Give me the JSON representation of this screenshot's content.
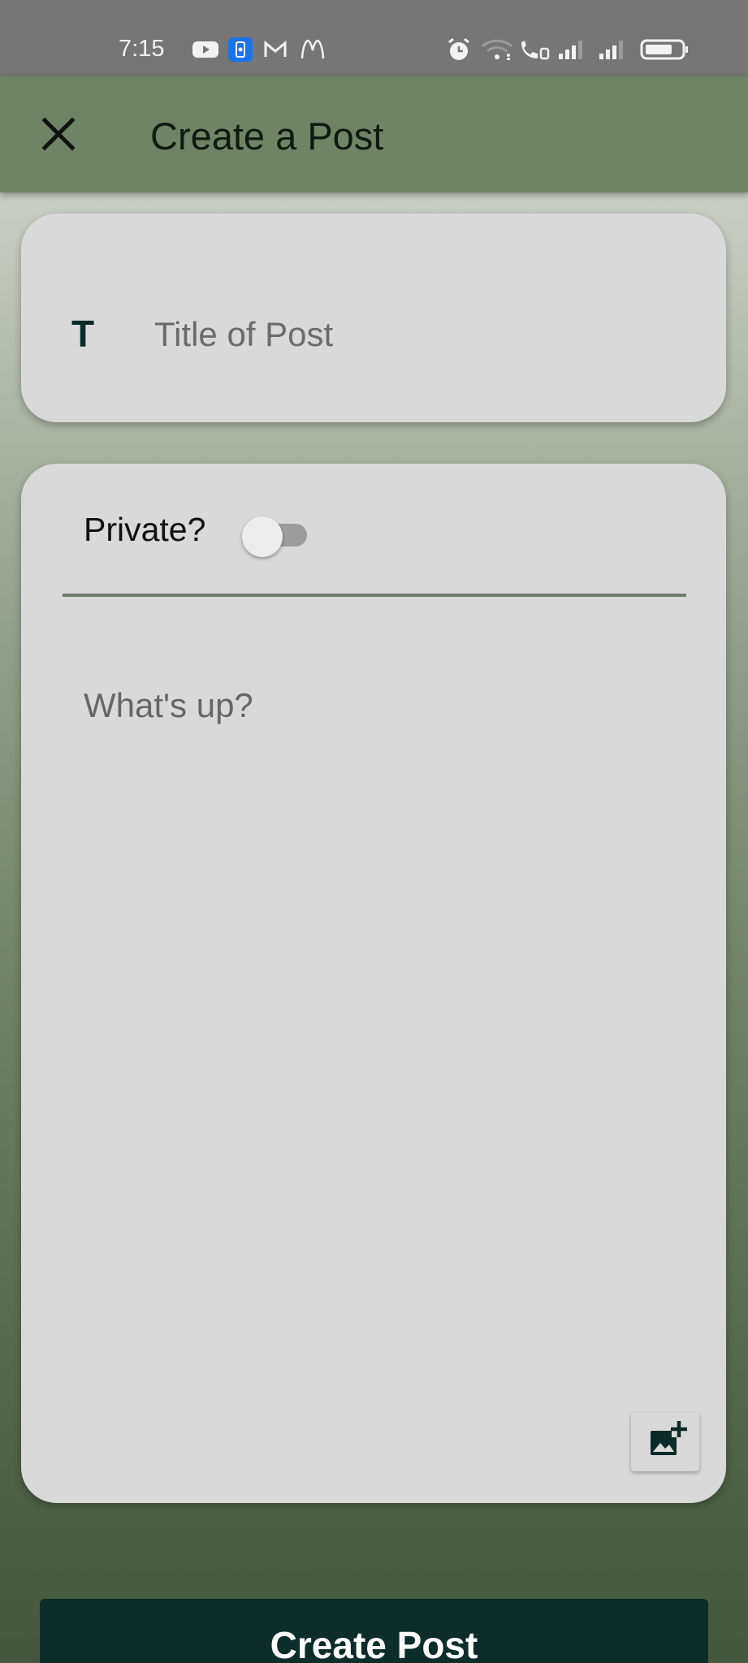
{
  "status_bar": {
    "time": "7:15",
    "icons": [
      "youtube-icon",
      "app-notification-icon",
      "gmail-icon",
      "mcdonalds-icon",
      "alarm-icon",
      "wifi-icon",
      "wifi-calling-icon",
      "signal-icon",
      "signal-icon",
      "battery-icon"
    ]
  },
  "app_bar": {
    "close_icon": "close-icon",
    "title": "Create a Post"
  },
  "title_field": {
    "icon_glyph": "T",
    "placeholder": "Title of Post",
    "value": ""
  },
  "body_field": {
    "private_label": "Private?",
    "private_on": false,
    "placeholder": "What's up?",
    "value": "",
    "add_image_icon": "add-photo-icon"
  },
  "submit": {
    "label": "Create Post"
  },
  "colors": {
    "app_bar": "#6f8467",
    "card": "#d9d9d9",
    "primary_button": "#0c2d2a",
    "status_bar": "#767676"
  }
}
